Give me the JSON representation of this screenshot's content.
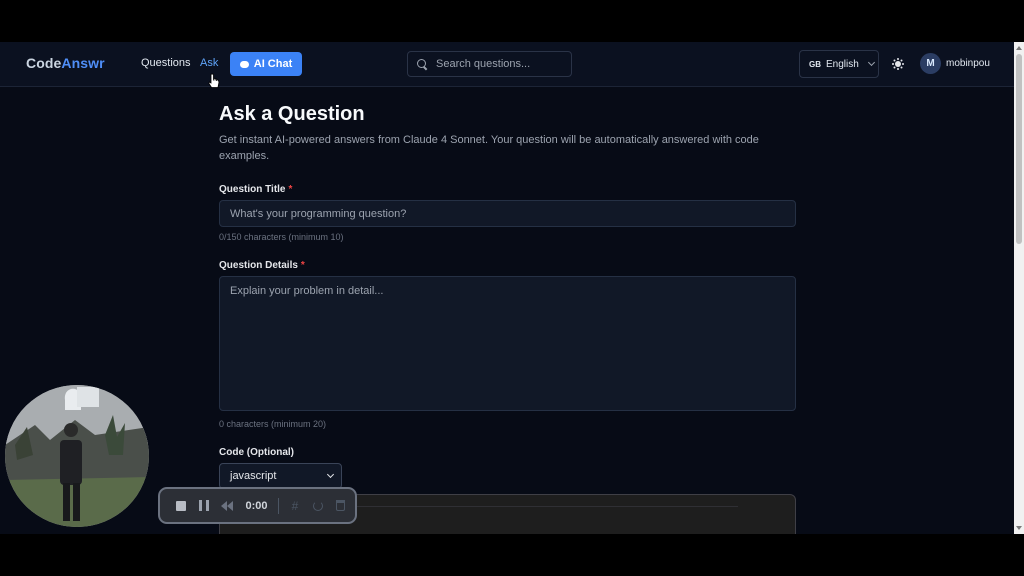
{
  "app": {
    "logo_main": "Code",
    "logo_accent": "Answr"
  },
  "nav": {
    "questions": "Questions",
    "ask": "Ask",
    "ai_chat": "AI Chat"
  },
  "search": {
    "placeholder": "Search questions...",
    "icon": "search-icon"
  },
  "language": {
    "flag": "GB",
    "selected": "English"
  },
  "user": {
    "avatar_initial": "M",
    "name": "mobinpou"
  },
  "form": {
    "title": "Ask a Question",
    "description": "Get instant AI-powered answers from Claude 4 Sonnet. Your question will be automatically answered with code examples.",
    "question_title": {
      "label": "Question Title",
      "required_mark": "*",
      "placeholder": "What's your programming question?",
      "value": "",
      "hint": "0/150 characters (minimum 10)"
    },
    "question_details": {
      "label": "Question Details",
      "required_mark": "*",
      "placeholder": "Explain your problem in detail...",
      "value": "",
      "hint": "0 characters (minimum 20)"
    },
    "code": {
      "label": "Code (Optional)",
      "language_selected": "javascript"
    }
  },
  "recorder": {
    "time": "0:00"
  },
  "colors": {
    "accent": "#3b82f6",
    "link_active": "#60a5fa",
    "background": "#070b16",
    "required": "#ef4444"
  }
}
